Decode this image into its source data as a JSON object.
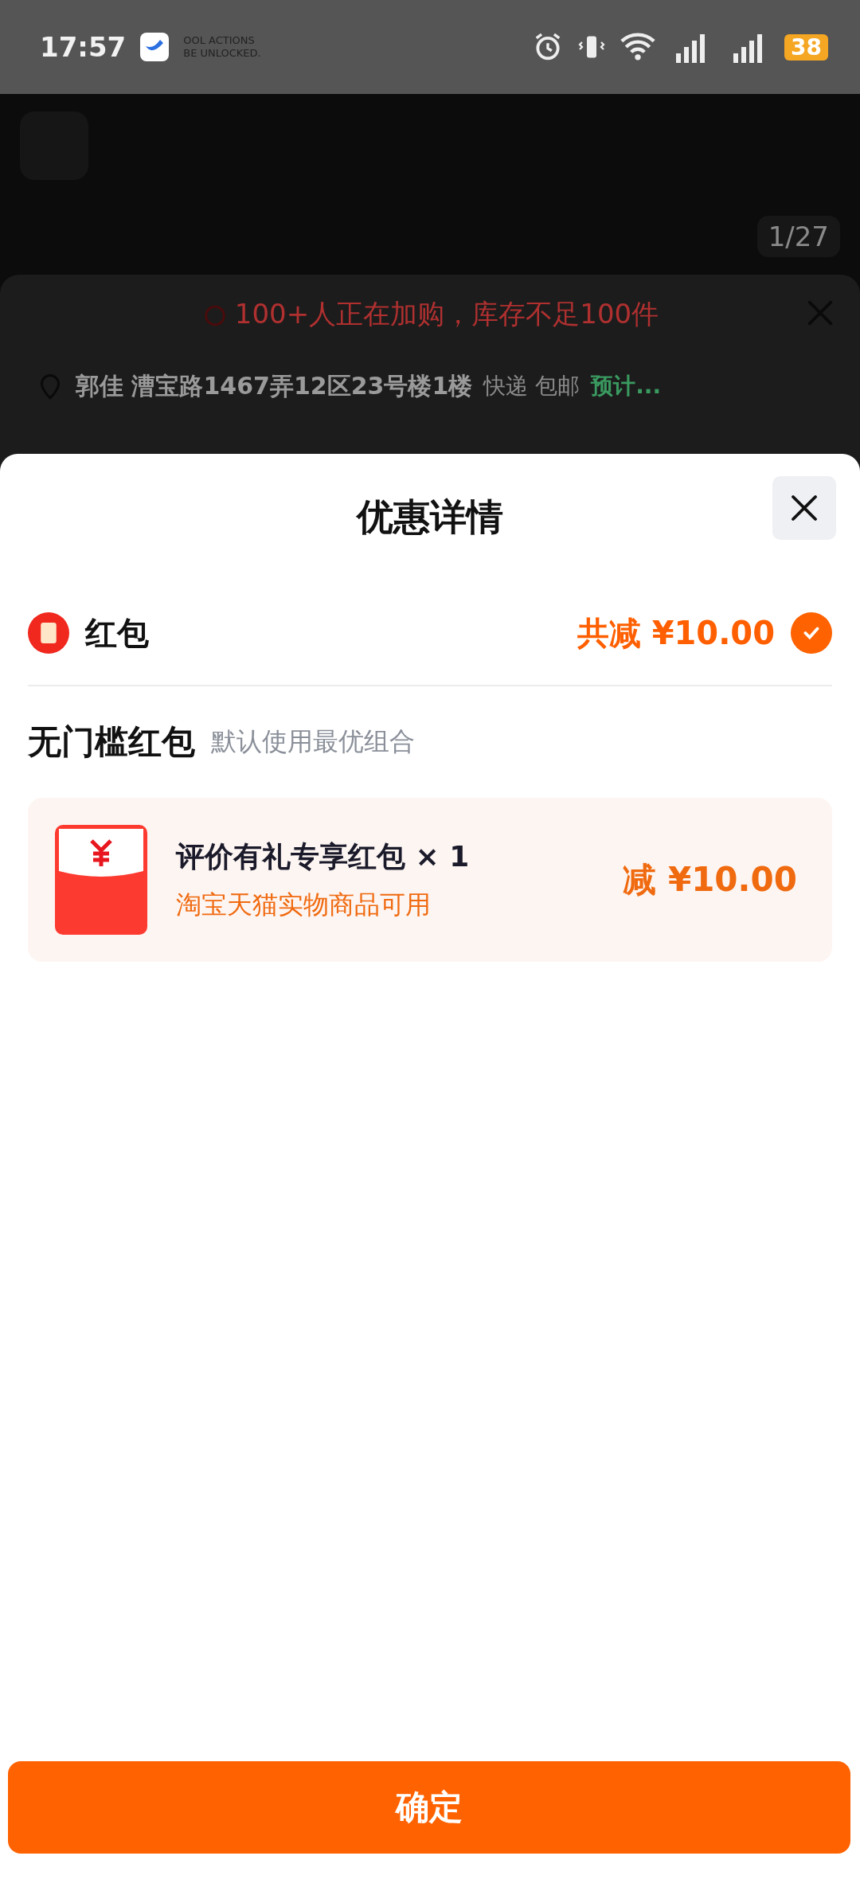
{
  "status_bar": {
    "time": "17:57",
    "notification": [
      "OOL ACTIONS",
      "BE UNLOCKED."
    ],
    "battery": "38"
  },
  "background": {
    "image_counter": "1/27",
    "banner": "100+人正在加购，库存不足100件",
    "address": {
      "name": "郭佳 漕宝路1467弄12区23号楼1楼",
      "shipping": "快递 包邮",
      "estimate": "预计..."
    }
  },
  "sheet": {
    "title": "优惠详情",
    "summary": {
      "label": "红包",
      "total": "共减 ¥10.00",
      "checked": true
    },
    "section": {
      "title": "无门槛红包",
      "hint": "默认使用最优组合"
    },
    "coupons": [
      {
        "name": "评价有礼专享红包 × 1",
        "scope": "淘宝天猫实物商品可用",
        "discount": "减 ¥10.00"
      }
    ],
    "confirm": "确定"
  }
}
